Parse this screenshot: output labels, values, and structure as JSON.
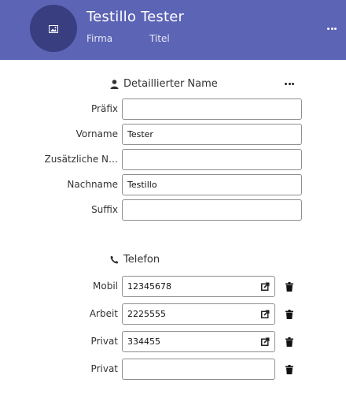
{
  "header": {
    "name": "Testillo Tester",
    "company": "Firma",
    "title": "Titel",
    "avatar_icon": "image-icon",
    "menu_icon": "more-horizontal-icon",
    "background_color": "#5c64b5",
    "avatar_color": "#383e80"
  },
  "name_section": {
    "heading": "Detaillierter Name",
    "icon": "person-icon",
    "menu_icon": "more-horizontal-icon",
    "fields": {
      "prefix": {
        "label": "Präfix",
        "value": ""
      },
      "first": {
        "label": "Vorname",
        "value": "Tester"
      },
      "additional": {
        "label": "Zusätzliche N…",
        "value": ""
      },
      "last": {
        "label": "Nachname",
        "value": "Testillo"
      },
      "suffix": {
        "label": "Suffix",
        "value": ""
      }
    }
  },
  "phone_section": {
    "heading": "Telefon",
    "icon": "phone-icon",
    "entries": [
      {
        "label": "Mobil",
        "value": "12345678",
        "link_icon": "external-link-icon",
        "delete_icon": "trash-icon"
      },
      {
        "label": "Arbeit",
        "value": "2225555",
        "link_icon": "external-link-icon",
        "delete_icon": "trash-icon"
      },
      {
        "label": "Privat",
        "value": "334455",
        "link_icon": "external-link-icon",
        "delete_icon": "trash-icon"
      },
      {
        "label": "Privat",
        "value": "",
        "delete_icon": "trash-icon"
      }
    ]
  }
}
